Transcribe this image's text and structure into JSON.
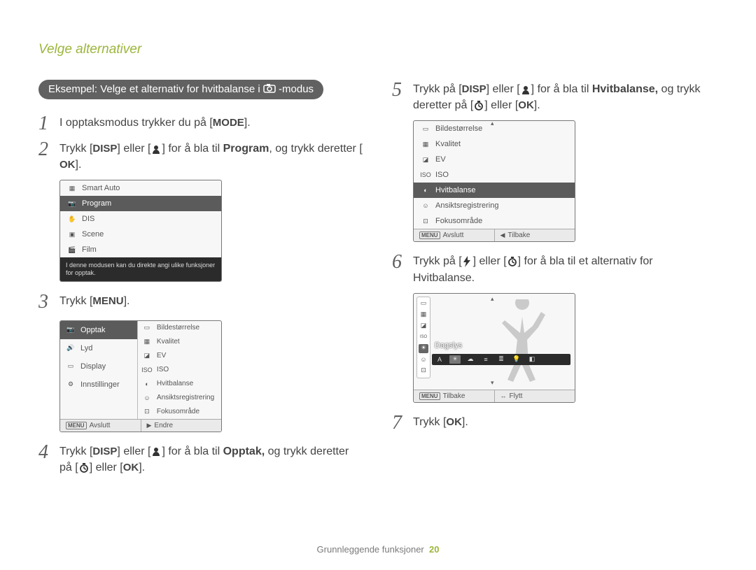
{
  "crumb": "Velge alternativer",
  "pill_prefix": "Eksempel: Velge et alternativ for hvitbalanse i ",
  "pill_suffix": " -modus",
  "steps": {
    "s1": {
      "num": "1",
      "t1": "I opptaksmodus trykker du på [",
      "key": "MODE",
      "t2": "]."
    },
    "s2": {
      "num": "2",
      "t1": "Trykk [",
      "k1": "DISP",
      "t2": "] eller [",
      "t3": "] for å bla til ",
      "bold": "Program",
      "t4": ", og trykk deretter [",
      "k2": "OK",
      "t5": "]."
    },
    "s3": {
      "num": "3",
      "t1": "Trykk [",
      "key": "MENU",
      "t2": "]."
    },
    "s4": {
      "num": "4",
      "t1": "Trykk [",
      "k1": "DISP",
      "t2": "] eller [",
      "t3": "] for å bla til ",
      "bold": "Opptak,",
      "t4": " og trykk deretter på [",
      "t5": "] eller [",
      "k2": "OK",
      "t6": "]."
    },
    "s5": {
      "num": "5",
      "t1": "Trykk på [",
      "k1": "DISP",
      "t2": "] eller [",
      "t3": "] for å bla til ",
      "bold": "Hvitbalanse,",
      "t4": " og trykk deretter på [",
      "t5": "] eller [",
      "k2": "OK",
      "t6": "]."
    },
    "s6": {
      "num": "6",
      "t1": "Trykk på [",
      "t2": "] eller [",
      "t3": "] for å bla til et alternativ for Hvitbalanse."
    },
    "s7": {
      "num": "7",
      "t1": "Trykk [",
      "key": "OK",
      "t2": "]."
    }
  },
  "panel_modes": {
    "items": [
      "Smart Auto",
      "Program",
      "DIS",
      "Scene",
      "Film"
    ],
    "selected_index": 1,
    "help": "I denne modusen kan du direkte angi ulike funksjoner for opptak."
  },
  "panel_menu": {
    "left": [
      "Opptak",
      "Lyd",
      "Display",
      "Innstillinger"
    ],
    "left_selected_index": 0,
    "right": [
      "Bildestørrelse",
      "Kvalitet",
      "EV",
      "ISO",
      "Hvitbalanse",
      "Ansiktsregistrering",
      "Fokusområde"
    ],
    "foot_left_key": "MENU",
    "foot_left": "Avslutt",
    "foot_right_icon": "▶",
    "foot_right": "Endre"
  },
  "panel_wb_list": {
    "items": [
      "Bildestørrelse",
      "Kvalitet",
      "EV",
      "ISO",
      "Hvitbalanse",
      "Ansiktsregistrering",
      "Fokusområde"
    ],
    "selected_index": 4,
    "foot_left_key": "MENU",
    "foot_left": "Avslutt",
    "foot_right_icon": "◀",
    "foot_right": "Tilbake"
  },
  "panel_wb_select": {
    "label": "Dagslys",
    "foot_left_key": "MENU",
    "foot_left": "Tilbake",
    "foot_right_icon": "↔",
    "foot_right": "Flytt"
  },
  "footer": {
    "text": "Grunnleggende funksjoner",
    "page": "20"
  }
}
